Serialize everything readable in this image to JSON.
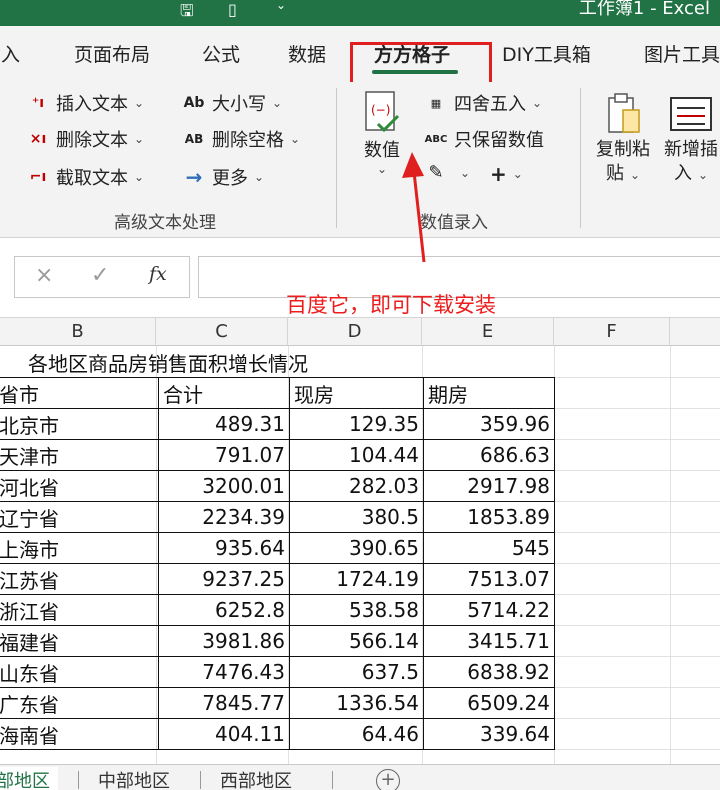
{
  "window": {
    "title": "工作簿1 - Excel"
  },
  "quick_access": {
    "save_icon": "save-icon",
    "new_icon": "new-file-icon",
    "more_icon": "chevron-down-icon"
  },
  "tabs": [
    {
      "label": "插入",
      "partial": true
    },
    {
      "label": "页面布局"
    },
    {
      "label": "公式"
    },
    {
      "label": "数据"
    },
    {
      "label": "方方格子",
      "active": true
    },
    {
      "label": "DIY工具箱"
    },
    {
      "label": "图片工具"
    }
  ],
  "ribbon": {
    "text_group": {
      "label": "高级文本处理",
      "insert_text": "插入文本",
      "delete_text": "删除文本",
      "extract_text": "截取文本",
      "case": "大小写",
      "remove_spaces": "删除空格",
      "more": "更多",
      "case_icon": "Ab",
      "spaces_icon": "AB"
    },
    "number_group": {
      "label": "数值录入",
      "numeric_big": "数值",
      "round": "四舍五入",
      "keep_values": "只保留数值",
      "keep_values_icon": "ABC",
      "plus": "+"
    },
    "paste_group": {
      "copy_paste_1": "复制粘",
      "copy_paste_2": "贴",
      "insert_1": "新增插",
      "insert_2": "入"
    }
  },
  "formula_bar": {
    "cancel": "×",
    "enter": "✓",
    "fx": "fx",
    "value": ""
  },
  "annotation": {
    "text": "百度它，即可下载安装",
    "color": "#ee1c1c"
  },
  "columns": [
    "B",
    "C",
    "D",
    "E",
    "F"
  ],
  "sheet": {
    "title": "各地区商品房销售面积增长情况",
    "headers": [
      "省市",
      "合计",
      "现房",
      "期房"
    ],
    "rows": [
      [
        "北京市",
        "489.31",
        "129.35",
        "359.96"
      ],
      [
        "天津市",
        "791.07",
        "104.44",
        "686.63"
      ],
      [
        "河北省",
        "3200.01",
        "282.03",
        "2917.98"
      ],
      [
        "辽宁省",
        "2234.39",
        "380.5",
        "1853.89"
      ],
      [
        "上海市",
        "935.64",
        "390.65",
        "545"
      ],
      [
        "江苏省",
        "9237.25",
        "1724.19",
        "7513.07"
      ],
      [
        "浙江省",
        "6252.8",
        "538.58",
        "5714.22"
      ],
      [
        "福建省",
        "3981.86",
        "566.14",
        "3415.71"
      ],
      [
        "山东省",
        "7476.43",
        "637.5",
        "6838.92"
      ],
      [
        "广东省",
        "7845.77",
        "1336.54",
        "6509.24"
      ],
      [
        "海南省",
        "404.11",
        "64.46",
        "339.64"
      ]
    ]
  },
  "sheet_tabs": [
    {
      "label": "东部地区",
      "active": true
    },
    {
      "label": "中部地区"
    },
    {
      "label": "西部地区"
    }
  ],
  "add_sheet": "+",
  "colors": {
    "excel_green": "#217346",
    "highlight_red": "#e02020",
    "ribbon_bg": "#f3f3f3"
  }
}
